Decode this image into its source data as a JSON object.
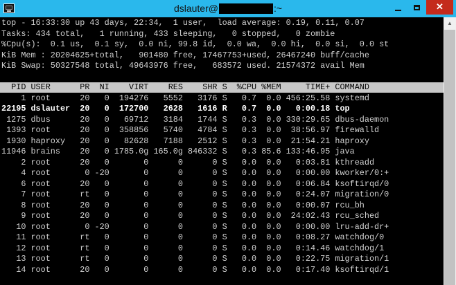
{
  "window": {
    "title_prefix": "dslauter@",
    "title_suffix": ":~",
    "minimize_glyph": "",
    "close_glyph": "✕",
    "scroll_up_glyph": "▲"
  },
  "summary": [
    "top - 16:33:30 up 43 days, 22:34,  1 user,  load average: 0.19, 0.11, 0.07",
    "Tasks: 434 total,   1 running, 433 sleeping,   0 stopped,   0 zombie",
    "%Cpu(s):  0.1 us,  0.1 sy,  0.0 ni, 99.8 id,  0.0 wa,  0.0 hi,  0.0 si,  0.0 st",
    "KiB Mem : 20204625+total,   901480 free, 17467753+used, 26467240 buff/cache",
    "KiB Swap: 50327548 total, 49643976 free,   683572 used. 21574372 avail Mem"
  ],
  "table_header": "  PID USER      PR  NI    VIRT    RES    SHR S  %CPU %MEM     TIME+ COMMAND",
  "processes": [
    "    1 root      20   0  194276   5552   3176 S   0.7  0.0 456:25.58 systemd",
    "22195 dslauter  20   0  172700   2628   1616 R   0.7  0.0   0:00.18 top",
    " 1275 dbus      20   0   69712   3184   1744 S   0.3  0.0 330:29.65 dbus-daemon",
    " 1393 root      20   0  358856   5740   4784 S   0.3  0.0  38:56.97 firewalld",
    " 1930 haproxy   20   0   82628   7188   2512 S   0.3  0.0  21:54.21 haproxy",
    "11946 brains    20   0 1785.0g 165.0g 846332 S   0.3 85.6 133:46.95 java",
    "    2 root      20   0       0      0      0 S   0.0  0.0   0:03.81 kthreadd",
    "    4 root       0 -20       0      0      0 S   0.0  0.0   0:00.00 kworker/0:+",
    "    6 root      20   0       0      0      0 S   0.0  0.0   0:06.84 ksoftirqd/0",
    "    7 root      rt   0       0      0      0 S   0.0  0.0   0:24.07 migration/0",
    "    8 root      20   0       0      0      0 S   0.0  0.0   0:00.07 rcu_bh",
    "    9 root      20   0       0      0      0 S   0.0  0.0  24:02.43 rcu_sched",
    "   10 root       0 -20       0      0      0 S   0.0  0.0   0:00.00 lru-add-dr+",
    "   11 root      rt   0       0      0      0 S   0.0  0.0   0:08.27 watchdog/0",
    "   12 root      rt   0       0      0      0 S   0.0  0.0   0:14.46 watchdog/1",
    "   13 root      rt   0       0      0      0 S   0.0  0.0   0:22.75 migration/1",
    "   14 root      20   0       0      0      0 S   0.0  0.0   0:17.40 ksoftirqd/1"
  ],
  "colors": {
    "titlebar": "#2ab8ec",
    "terminal_bg": "#000000",
    "terminal_fg": "#d2d2d2",
    "header_bg": "#c8c8c8",
    "close_button": "#c42b1c"
  }
}
